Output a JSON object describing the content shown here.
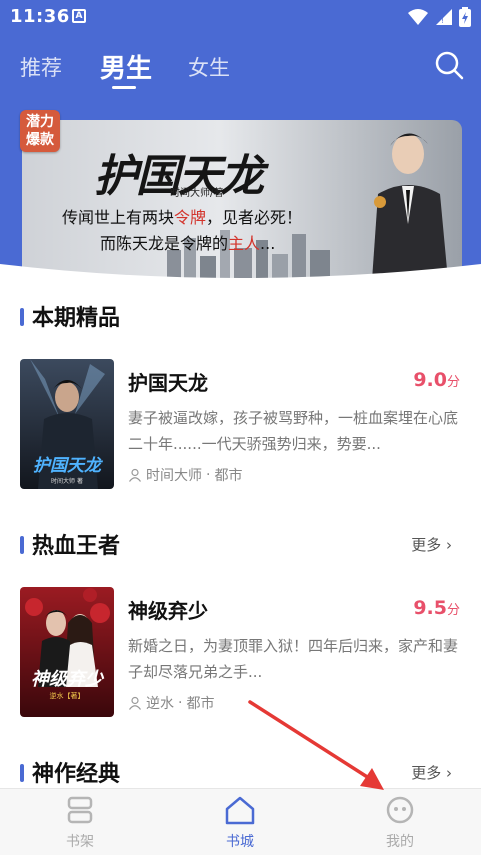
{
  "status_bar": {
    "time": "11:36",
    "notif_icon": "A"
  },
  "tabs": [
    {
      "label": "推荐"
    },
    {
      "label": "男生"
    },
    {
      "label": "女生"
    }
  ],
  "banner": {
    "badge": [
      "潜力",
      "爆款"
    ],
    "title": "护国天龙",
    "author": "时间大师/著",
    "line1_a": "传闻世上有两块",
    "line1_hl": "令牌",
    "line1_b": "，见者必死！",
    "line2_a": "而陈天龙是令牌的",
    "line2_hl": "主人",
    "line2_b": "..."
  },
  "sections": [
    {
      "title": "本期精品",
      "book": {
        "name": "护国天龙",
        "score": "9.0",
        "score_unit": "分",
        "desc": "妻子被逼改嫁，孩子被骂野种，一桩血案埋在心底二十年......一代天骄强势归来，势要...",
        "author": "时间大师",
        "category": "都市",
        "cover_text": "护国天龙",
        "cover_sub": "时间大师 著"
      }
    },
    {
      "title": "热血王者",
      "more": "更多",
      "book": {
        "name": "神级弃少",
        "score": "9.5",
        "score_unit": "分",
        "desc": "新婚之日，为妻顶罪入狱！四年后归来，家产和妻子却尽落兄弟之手...",
        "author": "逆水",
        "category": "都市",
        "cover_text": "神级弃少",
        "cover_sub": "逆水【著】"
      }
    },
    {
      "title": "神作经典",
      "more": "更多"
    }
  ],
  "bottom_nav": [
    {
      "label": "书架",
      "icon": "bookshelf-icon"
    },
    {
      "label": "书城",
      "icon": "home-icon",
      "active": true
    },
    {
      "label": "我的",
      "icon": "profile-face-icon"
    }
  ],
  "colors": {
    "brand": "#4a6ad3",
    "score": "#e8506a",
    "annotation_arrow": "#e53935"
  }
}
